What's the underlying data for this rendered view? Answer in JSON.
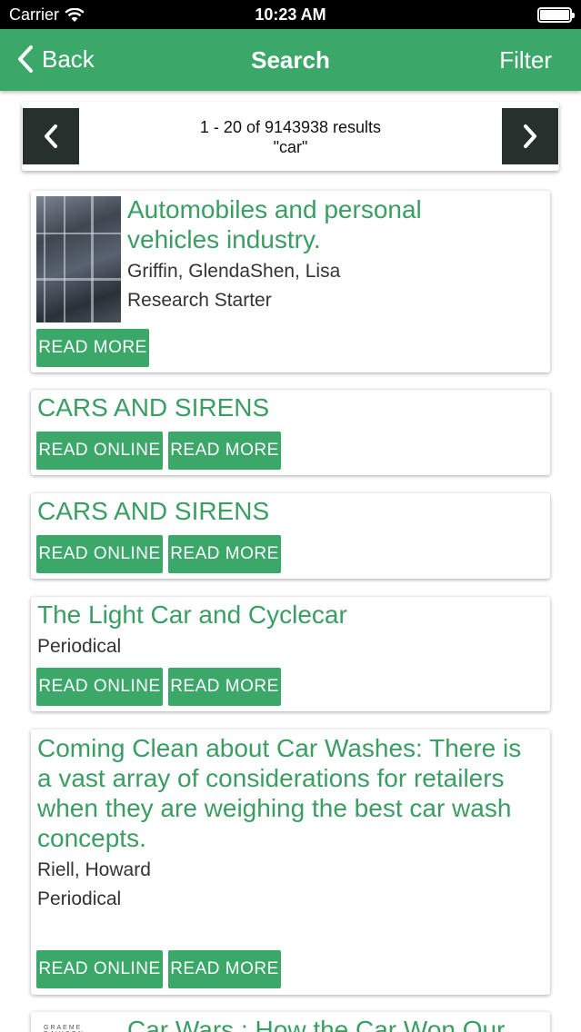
{
  "status": {
    "carrier": "Carrier",
    "time": "10:23 AM"
  },
  "nav": {
    "back_label": "Back",
    "title": "Search",
    "filter_label": "Filter"
  },
  "pager": {
    "range": "1 - 20 of 9143938 results",
    "query": "\"car\""
  },
  "results": [
    {
      "title_line1": "Automobiles and personal",
      "title_line2": "vehicles industry.",
      "author": "Griffin, GlendaShen, Lisa",
      "type": "Research Starter",
      "read_more": "READ MORE"
    },
    {
      "title": "CARS AND SIRENS",
      "read_online": "READ ONLINE",
      "read_more": "READ MORE"
    },
    {
      "title": "CARS AND SIRENS",
      "read_online": "READ ONLINE",
      "read_more": "READ MORE"
    },
    {
      "title": "The Light Car and Cyclecar",
      "type": "Periodical",
      "read_online": "READ ONLINE",
      "read_more": "READ MORE"
    },
    {
      "title_lines": [
        "Coming Clean about Car Washes: There is",
        "a vast array of considerations for retailers",
        "when they are weighing the best car wash",
        "concepts."
      ],
      "author": "Riell, Howard",
      "type": "Periodical",
      "read_online": "READ ONLINE",
      "read_more": "READ MORE"
    },
    {
      "title": "Car Wars : How the Car Won Our",
      "thumb_text": "GRAEME DAVISON"
    }
  ],
  "colors": {
    "accent": "#3ba769",
    "title_green": "#3a9e62",
    "pager_button": "#26302c"
  }
}
